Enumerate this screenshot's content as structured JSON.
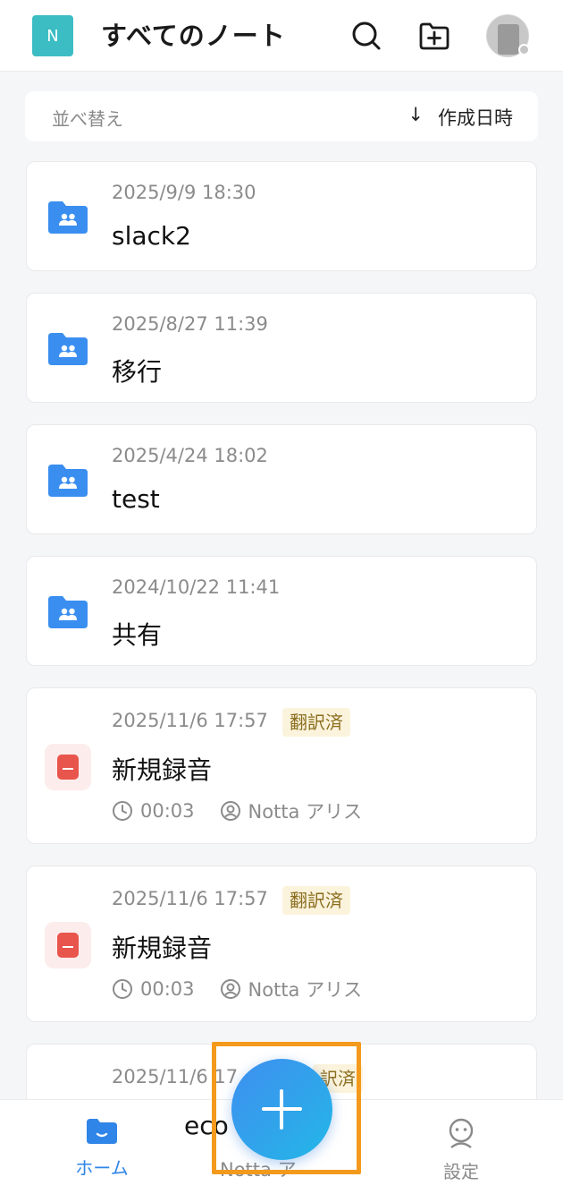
{
  "header": {
    "logo_letter": "N",
    "title": "すべてのノート",
    "icons": [
      "search-icon",
      "new-folder-icon",
      "avatar"
    ]
  },
  "sort": {
    "label": "並べ替え",
    "arrow": "↓",
    "value": "作成日時"
  },
  "folders": [
    {
      "date": "2025/9/9  18:30",
      "title": "slack2"
    },
    {
      "date": "2025/8/27  11:39",
      "title": "移行"
    },
    {
      "date": "2025/4/24  18:02",
      "title": "test"
    },
    {
      "date": "2024/10/22  11:41",
      "title": "共有"
    }
  ],
  "recordings": [
    {
      "date": "2025/11/6  17:57",
      "badge": "翻訳済",
      "title": "新規録音",
      "duration": "00:03",
      "owner": "Notta アリス"
    },
    {
      "date": "2025/11/6  17:57",
      "badge": "翻訳済",
      "title": "新規録音",
      "duration": "00:03",
      "owner": "Notta アリス"
    }
  ],
  "partial_card": {
    "date": "2025/11/6  17",
    "badge_fragment": "訳済",
    "title_fragment": "eco",
    "owner_fragment": "Notta ア"
  },
  "nav": {
    "home_label": "ホーム",
    "settings_label": "設定"
  },
  "colors": {
    "accent": "#2f85e8",
    "folder": "#3a8ef0",
    "record": "#e8554d",
    "badge_bg": "#fbf3dc",
    "highlight": "#f39a1c"
  }
}
